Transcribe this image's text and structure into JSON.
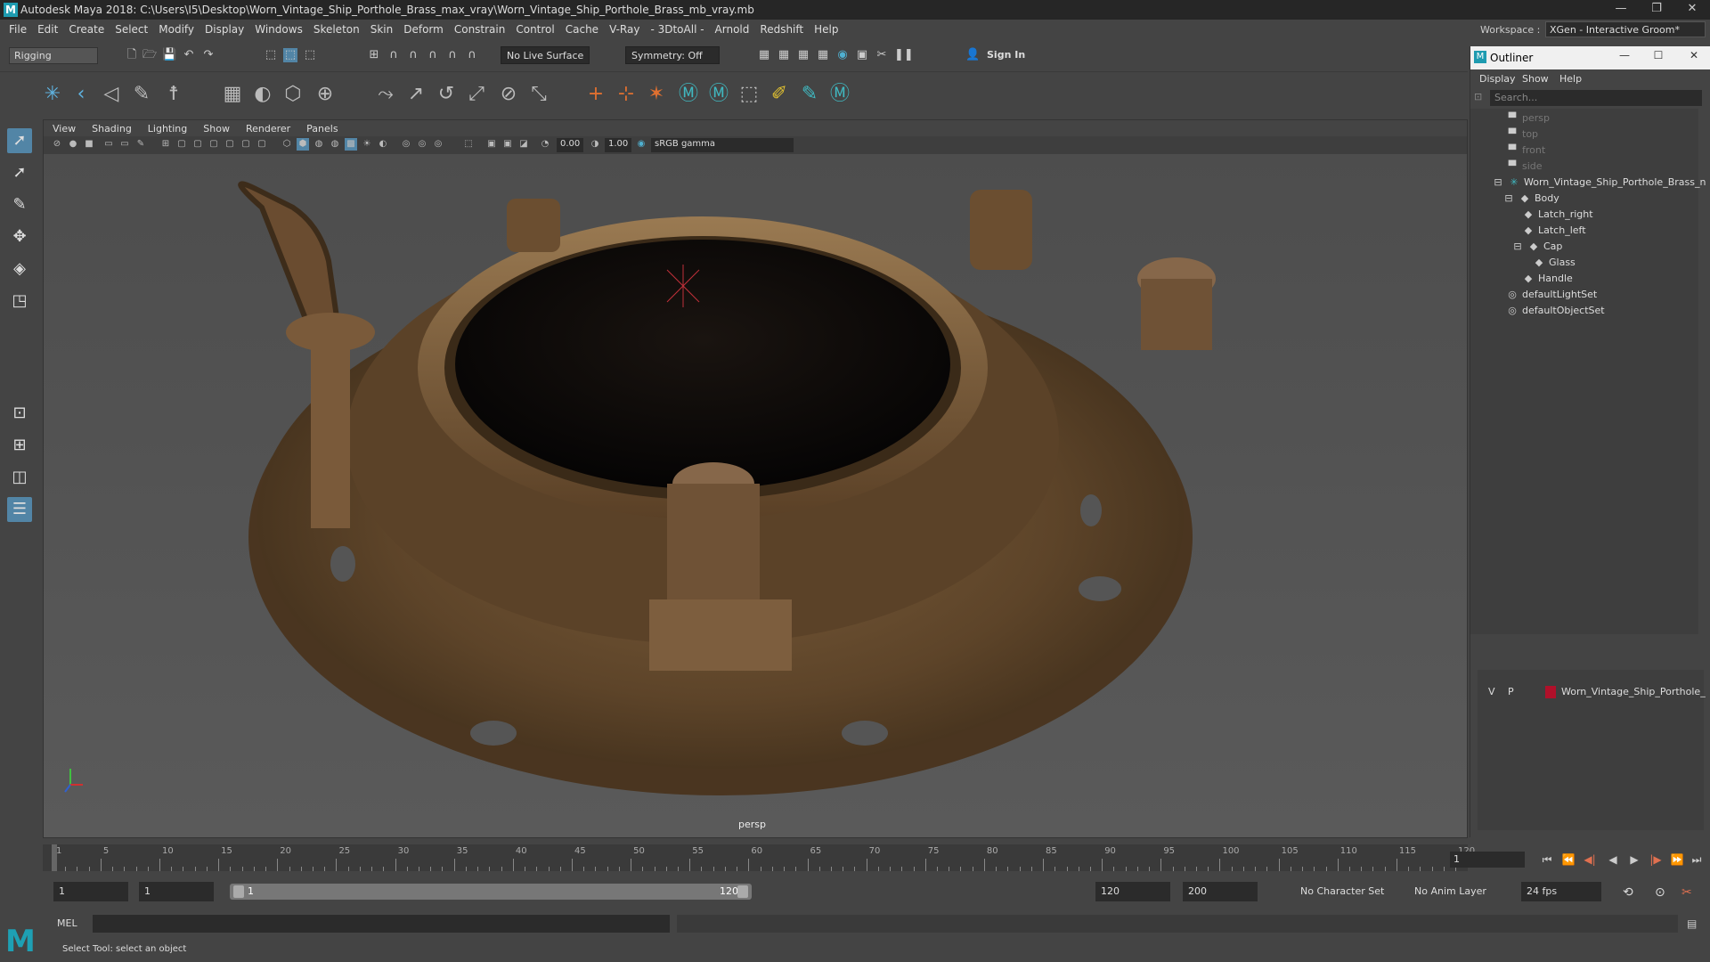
{
  "window": {
    "title": "Autodesk Maya 2018: C:\\Users\\I5\\Desktop\\Worn_Vintage_Ship_Porthole_Brass_max_vray\\Worn_Vintage_Ship_Porthole_Brass_mb_vray.mb",
    "minimize": "—",
    "restore": "❐",
    "close": "✕"
  },
  "menubar": {
    "items": [
      "File",
      "Edit",
      "Create",
      "Select",
      "Modify",
      "Display",
      "Windows",
      "Skeleton",
      "Skin",
      "Deform",
      "Constrain",
      "Control",
      "Cache",
      "V-Ray",
      "- 3DtoAll -",
      "Arnold",
      "Redshift",
      "Help"
    ]
  },
  "workspace": {
    "label": "Workspace :",
    "value": "XGen - Interactive Groom*"
  },
  "statusline": {
    "mode": "Rigging",
    "live_surface": "No Live Surface",
    "symmetry": "Symmetry: Off",
    "sign_in": "Sign In"
  },
  "viewport": {
    "menu": [
      "View",
      "Shading",
      "Lighting",
      "Show",
      "Renderer",
      "Panels"
    ],
    "exposure": "0.00",
    "gamma": "1.00",
    "color_space": "sRGB gamma",
    "camera_label": "persp"
  },
  "outliner": {
    "title": "Outliner",
    "menu": [
      "Display",
      "Show",
      "Help"
    ],
    "search_placeholder": "Search...",
    "nodes": [
      {
        "label": "persp",
        "dim": true
      },
      {
        "label": "top",
        "dim": true
      },
      {
        "label": "front",
        "dim": true
      },
      {
        "label": "side",
        "dim": true
      },
      {
        "label": "Worn_Vintage_Ship_Porthole_Brass_n",
        "dim": false
      },
      {
        "label": "Body",
        "dim": false
      },
      {
        "label": "Latch_right",
        "dim": false
      },
      {
        "label": "Latch_left",
        "dim": false
      },
      {
        "label": "Cap",
        "dim": false
      },
      {
        "label": "Glass",
        "dim": false
      },
      {
        "label": "Handle",
        "dim": false
      },
      {
        "label": "defaultLightSet",
        "dim": false
      },
      {
        "label": "defaultObjectSet",
        "dim": false
      }
    ],
    "layer": {
      "v": "V",
      "p": "P",
      "name": "Worn_Vintage_Ship_Porthole_",
      "color": "#b0102a"
    }
  },
  "timeslider": {
    "labels": [
      "1",
      "5",
      "10",
      "15",
      "20",
      "25",
      "30",
      "35",
      "40",
      "45",
      "50",
      "55",
      "60",
      "65",
      "70",
      "75",
      "80",
      "85",
      "90",
      "95",
      "100",
      "105",
      "110",
      "115",
      "120"
    ],
    "current_frame": "1"
  },
  "range": {
    "start": "1",
    "anim_start": "1",
    "slider_start": "1",
    "slider_end": "120",
    "anim_end": "120",
    "end": "200",
    "character_set": "No Character Set",
    "anim_layer": "No Anim Layer",
    "fps": "24 fps"
  },
  "commandline": {
    "label": "MEL",
    "help": "Select Tool: select an object"
  },
  "colors": {
    "accent": "#5285a6",
    "brand": "#1e9bb0"
  }
}
